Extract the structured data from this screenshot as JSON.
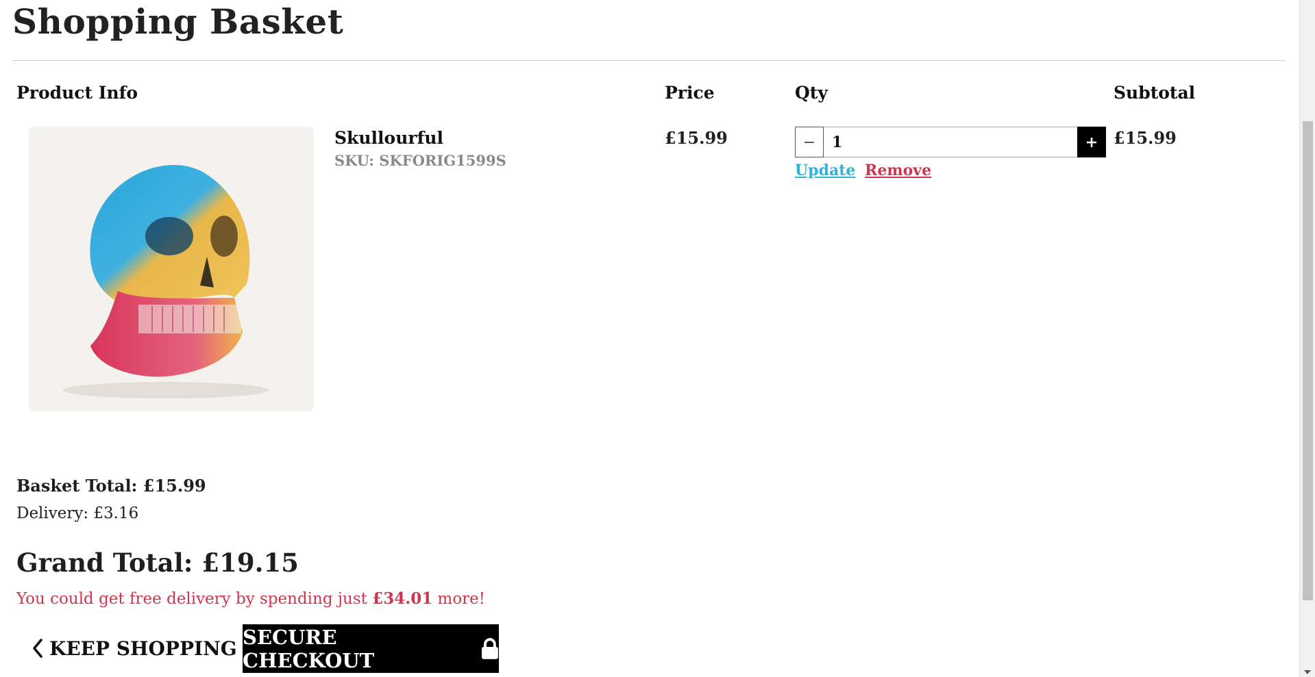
{
  "page": {
    "title": "Shopping Basket"
  },
  "table": {
    "headers": {
      "product_info": "Product Info",
      "price": "Price",
      "qty": "Qty",
      "subtotal": "Subtotal"
    }
  },
  "item": {
    "name": "Skullourful",
    "sku": "SKU: SKFORIG1599S",
    "price": "£15.99",
    "quantity": "1",
    "subtotal": "£15.99",
    "update_label": "Update",
    "remove_label": "Remove",
    "image_icon": "skull-artwork-image"
  },
  "totals": {
    "basket_total": "Basket Total: £15.99",
    "delivery": "Delivery: £3.16",
    "grand_total": "Grand Total: £19.15",
    "free_delivery_prefix": "You could get free delivery by spending just ",
    "free_delivery_amount": "£34.01",
    "free_delivery_suffix": " more!"
  },
  "actions": {
    "keep_shopping": "KEEP SHOPPING",
    "secure_checkout": "SECURE CHECKOUT"
  },
  "icons": {
    "minus": "minus-icon",
    "plus": "plus-icon",
    "back": "chevron-left-icon",
    "lock": "lock-icon"
  },
  "colors": {
    "update_link": "#2bb4d9",
    "remove_link": "#d0344c",
    "free_delivery_text": "#d0344c",
    "checkout_bg": "#000000"
  }
}
